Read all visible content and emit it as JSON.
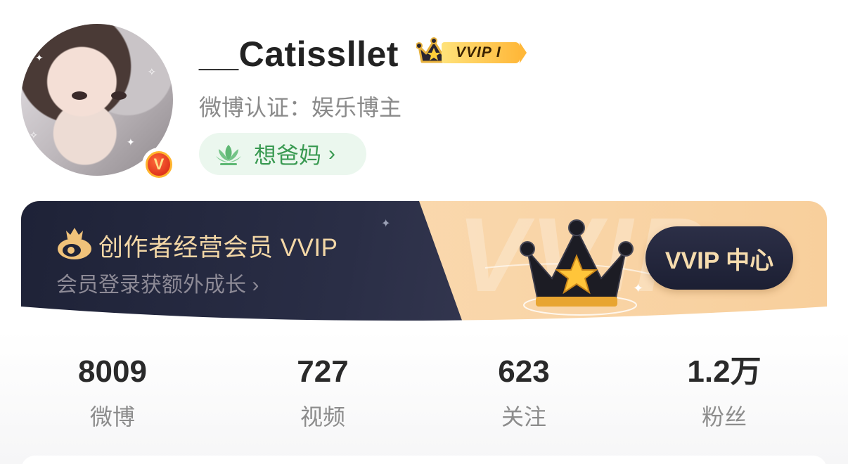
{
  "profile": {
    "username": "__Catissllet",
    "vip_badge": "VVIP I",
    "verification": "微博认证：娱乐博主",
    "tag_label": "想爸妈",
    "tag_chevron": "›",
    "avatar_icon": "user-avatar",
    "verified_badge_letter": "V"
  },
  "banner": {
    "title": "创作者经营会员 VVIP",
    "subtitle": "会员登录获额外成长 ›",
    "button_label": "VVIP 中心",
    "bg_watermark": "VVIP",
    "colors": {
      "dark": "#1e2237",
      "gold_text": "#f3d7a6",
      "light": "#f8cf9c"
    }
  },
  "stats": [
    {
      "value": "8009",
      "label": "微博"
    },
    {
      "value": "727",
      "label": "视频"
    },
    {
      "value": "623",
      "label": "关注"
    },
    {
      "value": "1.2万",
      "label": "粉丝"
    }
  ]
}
